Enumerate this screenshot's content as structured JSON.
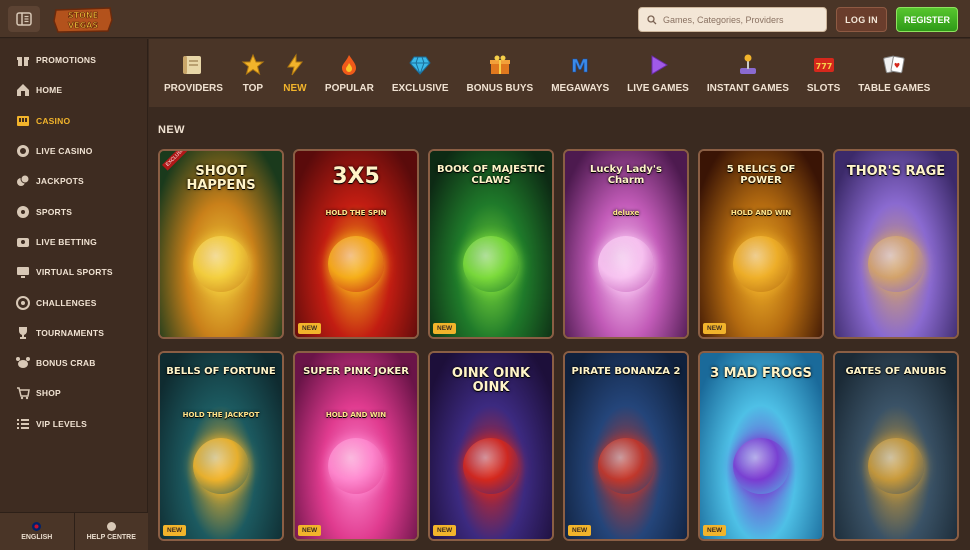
{
  "header": {
    "brand": "STONE VEGAS",
    "search_placeholder": "Games, Categories, Providers",
    "login_label": "LOG IN",
    "register_label": "REGISTER"
  },
  "sidebar": {
    "items": [
      {
        "label": "PROMOTIONS",
        "icon": "gift-icon"
      },
      {
        "label": "HOME",
        "icon": "home-icon"
      },
      {
        "label": "CASINO",
        "icon": "slot-machine-icon",
        "active": true
      },
      {
        "label": "LIVE CASINO",
        "icon": "chip-icon"
      },
      {
        "label": "JACKPOTS",
        "icon": "coins-icon"
      },
      {
        "label": "SPORTS",
        "icon": "ball-icon"
      },
      {
        "label": "LIVE BETTING",
        "icon": "live-icon"
      },
      {
        "label": "VIRTUAL SPORTS",
        "icon": "screen-icon"
      },
      {
        "label": "CHALLENGES",
        "icon": "target-icon"
      },
      {
        "label": "TOURNAMENTS",
        "icon": "trophy-icon"
      },
      {
        "label": "BONUS CRAB",
        "icon": "crab-icon"
      },
      {
        "label": "SHOP",
        "icon": "cart-icon"
      },
      {
        "label": "VIP LEVELS",
        "icon": "list-icon"
      }
    ],
    "language_label": "ENGLISH",
    "help_label": "HELP CENTRE"
  },
  "categories": [
    {
      "label": "PROVIDERS",
      "icon": "scroll-icon"
    },
    {
      "label": "TOP",
      "icon": "star-icon"
    },
    {
      "label": "NEW",
      "icon": "lightning-icon",
      "active": true
    },
    {
      "label": "POPULAR",
      "icon": "fire-icon"
    },
    {
      "label": "EXCLUSIVE",
      "icon": "diamond-icon"
    },
    {
      "label": "BONUS BUYS",
      "icon": "gift-box-icon"
    },
    {
      "label": "MEGAWAYS",
      "icon": "megaways-icon"
    },
    {
      "label": "LIVE GAMES",
      "icon": "play-icon"
    },
    {
      "label": "INSTANT GAMES",
      "icon": "joystick-icon"
    },
    {
      "label": "SLOTS",
      "icon": "777-icon"
    },
    {
      "label": "TABLE GAMES",
      "icon": "cards-icon"
    }
  ],
  "section_title": "NEW",
  "games": [
    {
      "title": "SHOOT HAPPENS",
      "badge": "",
      "ribbon": "EXCLUSIVE",
      "colors": [
        "#1a3a1c",
        "#c9801a",
        "#f4d03f"
      ]
    },
    {
      "title": "3X5",
      "subtitle": "HOLD THE SPIN",
      "badge": "NEW",
      "colors": [
        "#5a0b0b",
        "#c21d12",
        "#f6b01a"
      ]
    },
    {
      "title": "BOOK OF MAJESTIC CLAWS",
      "badge": "NEW",
      "colors": [
        "#0d2a14",
        "#1f7a2a",
        "#7ddc3c"
      ]
    },
    {
      "title": "Lucky Lady's Charm",
      "subtitle": "deluxe",
      "badge": "",
      "colors": [
        "#4d1a4f",
        "#c25bb8",
        "#f9c6f2"
      ]
    },
    {
      "title": "5 RELICS OF POWER",
      "subtitle": "HOLD AND WIN",
      "badge": "NEW",
      "colors": [
        "#3a1405",
        "#b36a10",
        "#f0b12a"
      ]
    },
    {
      "title": "THOR'S RAGE",
      "badge": "",
      "colors": [
        "#3c2a6a",
        "#8a6ad0",
        "#d3a36a"
      ]
    },
    {
      "title": "BELLS OF FORTUNE",
      "subtitle": "HOLD THE JACKPOT",
      "badge": "NEW",
      "colors": [
        "#0f2b30",
        "#1c5a60",
        "#f2b42b"
      ]
    },
    {
      "title": "SUPER PINK JOKER",
      "subtitle": "HOLD AND WIN",
      "badge": "NEW",
      "colors": [
        "#6a1448",
        "#e03b8f",
        "#ff8ad0"
      ]
    },
    {
      "title": "OINK OINK OINK",
      "badge": "NEW",
      "colors": [
        "#1d0f3a",
        "#3c2a80",
        "#d6281c"
      ]
    },
    {
      "title": "PIRATE BONANZA 2",
      "badge": "NEW",
      "colors": [
        "#10213d",
        "#24457a",
        "#c4372a"
      ]
    },
    {
      "title": "3 MAD FROGS",
      "badge": "NEW",
      "colors": [
        "#1a6a9a",
        "#4ec0e6",
        "#7b3ad1"
      ]
    },
    {
      "title": "GATES OF ANUBIS",
      "badge": "",
      "colors": [
        "#1b2a36",
        "#3a5266",
        "#c99a3a"
      ]
    }
  ],
  "accent": "#f2b42b"
}
